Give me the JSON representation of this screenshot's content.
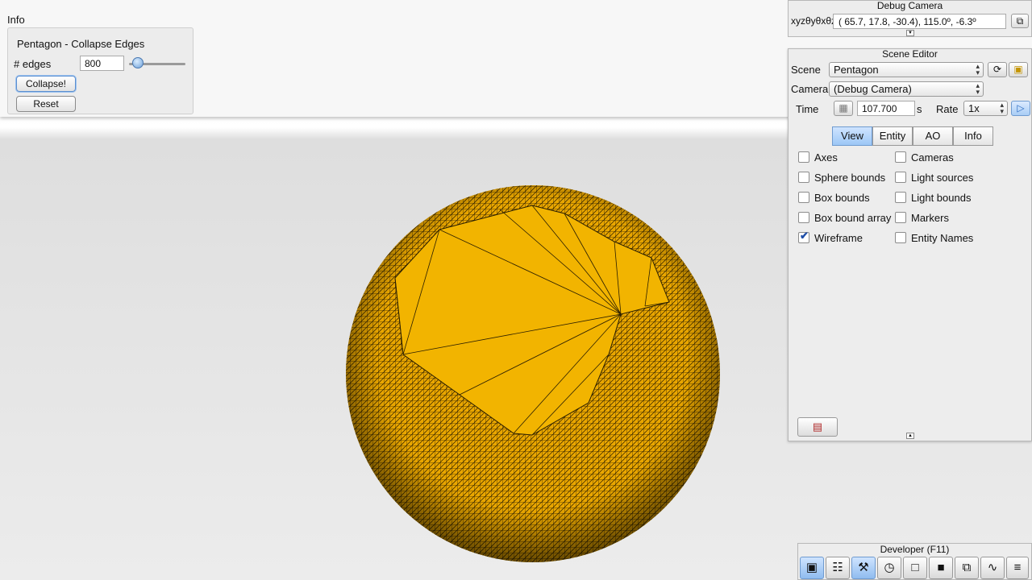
{
  "info_window": {
    "title": "Info",
    "pane_title": "Pentagon - Collapse Edges",
    "edges_label": "# edges",
    "edges_value": "800",
    "edges_slider_fraction": 0.08,
    "collapse_label": "Collapse!",
    "reset_label": "Reset"
  },
  "debug_camera": {
    "title": "Debug Camera",
    "coord_label": "xyzθyθxθz",
    "coords": "( 65.7,  17.8, -30.4),  115.0º,  -6.3º"
  },
  "scene_editor": {
    "title": "Scene Editor",
    "scene_label": "Scene",
    "scene_value": "Pentagon",
    "camera_label": "Camera",
    "camera_value": "(Debug Camera)",
    "time_label": "Time",
    "time_value": "107.700",
    "time_unit": "s",
    "rate_label": "Rate",
    "rate_value": "1x",
    "tabs": [
      "View",
      "Entity",
      "AO",
      "Info"
    ],
    "active_tab": "View",
    "checkboxes_left": [
      {
        "label": "Axes",
        "checked": false
      },
      {
        "label": "Sphere bounds",
        "checked": false
      },
      {
        "label": "Box bounds",
        "checked": false
      },
      {
        "label": "Box bound array",
        "checked": false
      },
      {
        "label": "Wireframe",
        "checked": true
      }
    ],
    "checkboxes_right": [
      {
        "label": "Cameras",
        "checked": false
      },
      {
        "label": "Light sources",
        "checked": false
      },
      {
        "label": "Light bounds",
        "checked": false
      },
      {
        "label": "Markers",
        "checked": false
      },
      {
        "label": "Entity Names",
        "checked": false
      }
    ]
  },
  "developer": {
    "title": "Developer (F11)",
    "buttons": [
      {
        "icon": "camera-icon",
        "glyph": "▣"
      },
      {
        "icon": "clapperboard-icon",
        "glyph": "☷"
      },
      {
        "icon": "tools-icon",
        "glyph": "⚒"
      },
      {
        "icon": "clock-icon",
        "glyph": "◷"
      },
      {
        "icon": "document-icon",
        "glyph": "□"
      },
      {
        "icon": "console-icon",
        "glyph": "■"
      },
      {
        "icon": "windows-icon",
        "glyph": "⧉"
      },
      {
        "icon": "profiler-icon",
        "glyph": "∿"
      },
      {
        "icon": "log-icon",
        "glyph": "≡"
      }
    ]
  },
  "colors": {
    "mesh_fill": "#e9a600",
    "mesh_fill_light": "#f2b400",
    "wire": "#2a1e00",
    "accent": "#9cc7f6"
  }
}
